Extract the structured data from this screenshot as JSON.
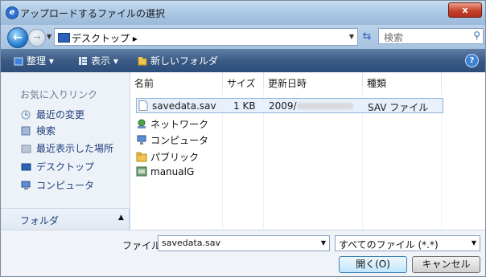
{
  "window": {
    "title": "アップロードするファイルの選択",
    "close_label": "x"
  },
  "address": {
    "breadcrumb": "デスクトップ ▸",
    "search_placeholder": "検索"
  },
  "toolbar": {
    "organize": "整理 ▾",
    "views": "表示 ▾",
    "new_folder": "新しいフォルダ"
  },
  "sidebar": {
    "heading": "お気に入りリンク",
    "items": [
      {
        "label": "最近の変更",
        "icon": "recent-changes-icon"
      },
      {
        "label": "検索",
        "icon": "search-folder-icon"
      },
      {
        "label": "最近表示した場所",
        "icon": "recent-places-icon"
      },
      {
        "label": "デスクトップ",
        "icon": "desktop-icon"
      },
      {
        "label": "コンピュータ",
        "icon": "computer-icon"
      }
    ],
    "folders_label": "フォルダ"
  },
  "filelist": {
    "columns": [
      "名前",
      "サイズ",
      "更新日時",
      "種類"
    ],
    "selected_file": {
      "name": "savedata.sav",
      "size": "1 KB",
      "date_prefix": "2009/",
      "type": "SAV ファイル"
    },
    "items": [
      {
        "label": "ネットワーク",
        "icon": "network-icon"
      },
      {
        "label": "コンピュータ",
        "icon": "computer-icon"
      },
      {
        "label": "パブリック",
        "icon": "folder-icon"
      },
      {
        "label": "manualG",
        "icon": "folder-icon"
      }
    ]
  },
  "bottom": {
    "filename_label": "ファイル名(N):",
    "filename_value": "savedata.sav",
    "filetype_value": "すべてのファイル (*.*)",
    "open_label": "開く(O)",
    "cancel_label": "キャンセル"
  }
}
